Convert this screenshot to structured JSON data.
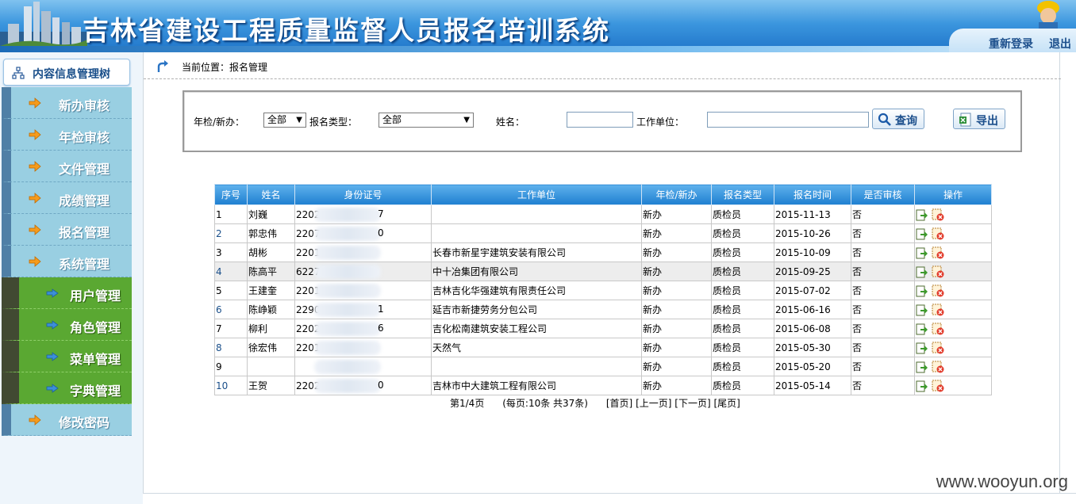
{
  "header": {
    "title": "吉林省建设工程质量监督人员报名培训系统",
    "relogin": "重新登录",
    "logout": "退出"
  },
  "sidebar": {
    "tree_title": "内容信息管理树",
    "items": [
      {
        "label": "新办审核"
      },
      {
        "label": "年检审核"
      },
      {
        "label": "文件管理"
      },
      {
        "label": "成绩管理"
      },
      {
        "label": "报名管理"
      },
      {
        "label": "系统管理"
      }
    ],
    "sub_items": [
      {
        "label": "用户管理"
      },
      {
        "label": "角色管理"
      },
      {
        "label": "菜单管理"
      },
      {
        "label": "字典管理"
      }
    ],
    "last_item": {
      "label": "修改密码"
    }
  },
  "breadcrumb": "当前位置：报名管理",
  "search": {
    "year_label": "年检/新办：",
    "year_value": "全部",
    "type_label": "报名类型：",
    "type_value": "全部",
    "name_label": "姓名：",
    "name_value": "",
    "org_label": "工作单位：",
    "org_value": "",
    "query_button": "查询",
    "export_button": "导出"
  },
  "table": {
    "headers": [
      "序号",
      "姓名",
      "身份证号",
      "工作单位",
      "年检/新办",
      "报名类型",
      "报名时间",
      "是否审核",
      "操作"
    ],
    "rows": [
      {
        "no": "1",
        "name": "刘巍",
        "id_start": "2202",
        "id_end": "7",
        "org": "",
        "kind": "新办",
        "type": "质检员",
        "date": "2015-11-13",
        "audited": "否"
      },
      {
        "no": "2",
        "name": "郭忠伟",
        "id_start": "2207",
        "id_end": "0",
        "org": "",
        "kind": "新办",
        "type": "质检员",
        "date": "2015-10-26",
        "audited": "否"
      },
      {
        "no": "3",
        "name": "胡彬",
        "id_start": "2201",
        "id_end": "",
        "org": "长春市新星宇建筑安装有限公司",
        "kind": "新办",
        "type": "质检员",
        "date": "2015-10-09",
        "audited": "否"
      },
      {
        "no": "4",
        "name": "陈高平",
        "id_start": "6227",
        "id_end": "",
        "org": "中十冶集团有限公司",
        "kind": "新办",
        "type": "质检员",
        "date": "2015-09-25",
        "audited": "否"
      },
      {
        "no": "5",
        "name": "王建奎",
        "id_start": "2201",
        "id_end": "",
        "org": "吉林吉化华强建筑有限责任公司",
        "kind": "新办",
        "type": "质检员",
        "date": "2015-07-02",
        "audited": "否"
      },
      {
        "no": "6",
        "name": "陈峥颖",
        "id_start": "2290",
        "id_end": "1",
        "org": "延吉市新捷劳务分包公司",
        "kind": "新办",
        "type": "质检员",
        "date": "2015-06-16",
        "audited": "否"
      },
      {
        "no": "7",
        "name": "柳利",
        "id_start": "2202",
        "id_end": "6",
        "org": "吉化松南建筑安装工程公司",
        "kind": "新办",
        "type": "质检员",
        "date": "2015-06-08",
        "audited": "否"
      },
      {
        "no": "8",
        "name": "徐宏伟",
        "id_start": "2201",
        "id_end": "",
        "org": "天然气",
        "kind": "新办",
        "type": "质检员",
        "date": "2015-05-30",
        "audited": "否"
      },
      {
        "no": "9",
        "name": "",
        "id_start": "",
        "id_end": "",
        "org": "",
        "kind": "新办",
        "type": "质检员",
        "date": "2015-05-20",
        "audited": "否"
      },
      {
        "no": "10",
        "name": "王贺",
        "id_start": "2202",
        "id_end": "0",
        "org": "吉林市中大建筑工程有限公司",
        "kind": "新办",
        "type": "质检员",
        "date": "2015-05-14",
        "audited": "否"
      }
    ]
  },
  "pager": {
    "page_info": "第1/4页",
    "count_info": "(每页:10条 共37条)",
    "first": "[首页]",
    "prev": "[上一页]",
    "next": "[下一页]",
    "last": "[尾页]"
  },
  "watermark": "www.wooyun.org"
}
